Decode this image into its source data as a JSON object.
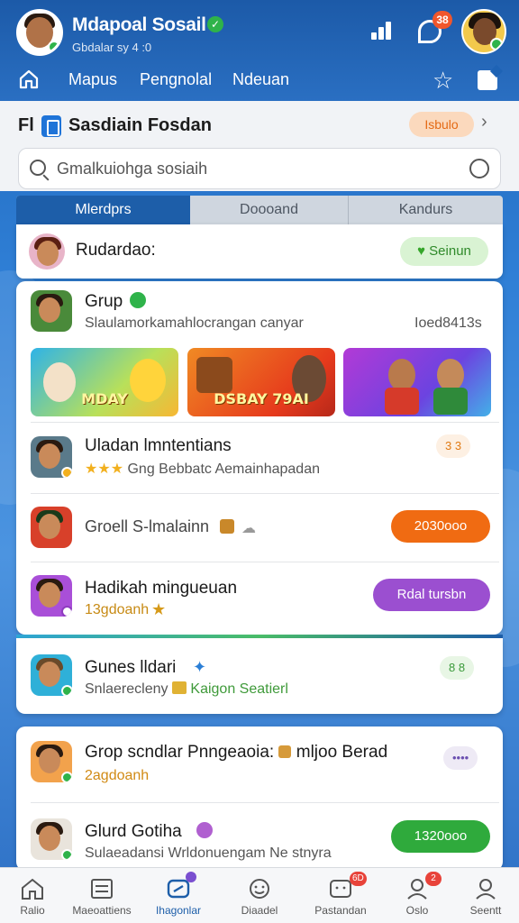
{
  "header": {
    "title": "Mdapoal Sosail",
    "subtitle": "Gbdalar sy 4 :0",
    "notification_count": "38"
  },
  "nav": {
    "items": [
      "Mapus",
      "Pengnolal",
      "Ndeuan"
    ]
  },
  "section": {
    "prefix": "Fl",
    "title": "Sasdiain Fosdan",
    "chip": "Isbulo"
  },
  "search": {
    "placeholder": "Gmalkuiohga sosiaih"
  },
  "tabs": [
    {
      "label": "Mlerdprs",
      "active": true
    },
    {
      "label": "Doooand",
      "active": false
    },
    {
      "label": "Kandurs",
      "active": false
    }
  ],
  "profile_row": {
    "name": "Rudardao:",
    "button": "Seinun"
  },
  "group_card": {
    "title": "Grup",
    "subtitle": "Slaulamorkamahlocrangan canyar",
    "meta": "Ioed8413s",
    "thumbnails": [
      "MDAY",
      "DSBAY 79AI",
      ""
    ]
  },
  "rows": [
    {
      "title": "Uladan lmntentians",
      "subtitle": "Gng Bebbatc Aemainhapadan",
      "badge": "3 3"
    },
    {
      "title": "Groell S-lmalainn",
      "subtitle": "",
      "button": "2030ooo"
    },
    {
      "title": "Hadikah mingueuan",
      "subtitle": "13gdoanh",
      "button": "Rdal tursbn"
    }
  ],
  "card3": {
    "title": "Gunes lldari",
    "subtitle_a": "Snlaerecleny",
    "subtitle_b": "Kaigon Seatierl",
    "badge": "8 8"
  },
  "card4": {
    "rows": [
      {
        "title": "Grop scndlar Pnngeaoia:",
        "title_tail": "mljoo Berad",
        "subtitle": "2agdoanh",
        "button": "••••"
      },
      {
        "title": "Glurd Gotiha",
        "subtitle": "Sulaeadansi Wrldonuengam Ne stnyra",
        "button": "1320ooo"
      }
    ]
  },
  "bottom_nav": [
    {
      "label": "Ralio",
      "badge": ""
    },
    {
      "label": "Maeoattiens",
      "badge": ""
    },
    {
      "label": "Ihagonlar",
      "badge": "",
      "active": true
    },
    {
      "label": "Diaadel",
      "badge": ""
    },
    {
      "label": "Pastandan",
      "badge": "6D"
    },
    {
      "label": "Oslo",
      "badge": "2"
    },
    {
      "label": "Seentt",
      "badge": ""
    }
  ],
  "colors": {
    "brand": "#1d5ea9",
    "orange": "#f06b12",
    "purple": "#9b4fd0",
    "green": "#2faa3c"
  }
}
